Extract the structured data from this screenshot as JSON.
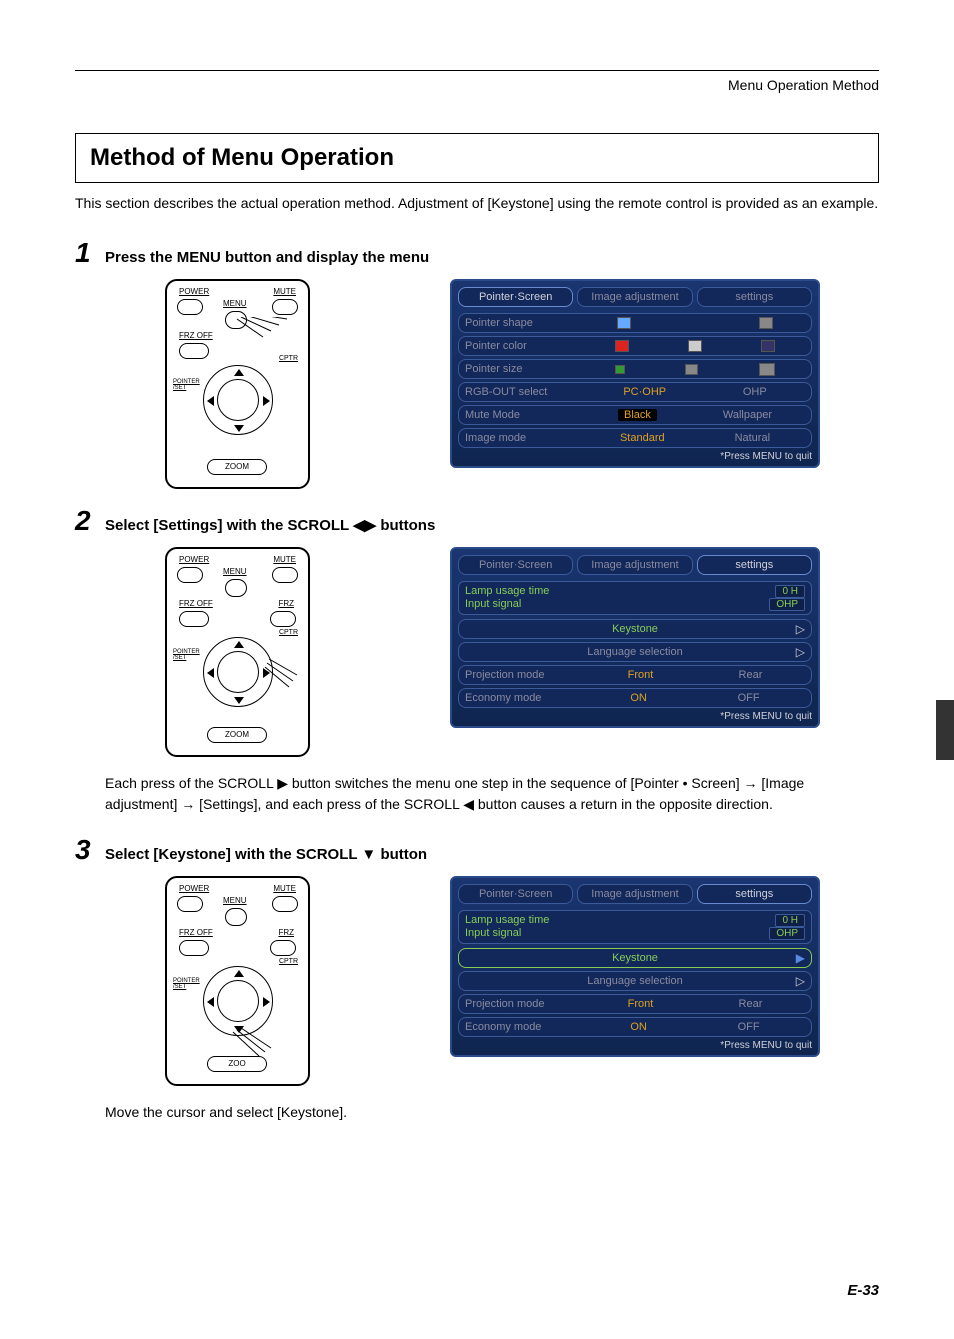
{
  "header": "Menu Operation Method",
  "title": "Method of Menu Operation",
  "intro": "This section describes the actual operation method. Adjustment of [Keystone] using the remote control is provided as an example.",
  "steps": [
    {
      "num": "1",
      "title": "Press the MENU button and display the menu",
      "remote_labels": {
        "power": "POWER",
        "mute": "MUTE",
        "menu": "MENU",
        "frzoff": "FRZ OFF",
        "frz": "FRZ",
        "cptr": "CPTR",
        "pointer": "POINTER\n/SET",
        "zoom": "ZOOM"
      }
    },
    {
      "num": "2",
      "title": "Select [Settings] with the SCROLL ◀▶ buttons",
      "body": "Each press of the SCROLL ▶ button switches the menu one step in the sequence of [Pointer • Screen] → [Image adjustment] → [Settings], and each press of the SCROLL ◀ button causes a return in the opposite direction."
    },
    {
      "num": "3",
      "title": "Select [Keystone] with the SCROLL ▼ button",
      "body": "Move the cursor and select [Keystone]."
    }
  ],
  "osd1": {
    "tabs": [
      "Pointer·Screen",
      "Image adjustment",
      "settings"
    ],
    "active": 0,
    "rows": [
      {
        "label": "Pointer shape",
        "type": "swatches",
        "opts": [
          "cursor",
          "",
          "line"
        ]
      },
      {
        "label": "Pointer color",
        "type": "swatches",
        "opts": [
          "r",
          "g",
          "b"
        ]
      },
      {
        "label": "Pointer size",
        "type": "swatches",
        "opts": [
          "sm",
          "md",
          "lg"
        ]
      },
      {
        "label": "RGB-OUT select",
        "type": "text",
        "opts": [
          "PC·OHP",
          "OHP"
        ],
        "hl": 0
      },
      {
        "label": "Mute Mode",
        "type": "text",
        "opts": [
          "Black",
          "Wallpaper"
        ],
        "hl": 0,
        "blk": true
      },
      {
        "label": "Image mode",
        "type": "text",
        "opts": [
          "Standard",
          "Natural"
        ],
        "hl": 0
      }
    ],
    "quit": "*Press MENU to quit"
  },
  "osd2": {
    "tabs": [
      "Pointer·Screen",
      "Image adjustment",
      "settings"
    ],
    "active": 2,
    "info": [
      {
        "label": "Lamp usage time",
        "val": "0 H"
      },
      {
        "label": "Input signal",
        "val": "OHP"
      }
    ],
    "btns": [
      "Keystone",
      "Language selection"
    ],
    "sel_btn": -1,
    "rows": [
      {
        "label": "Projection mode",
        "opts": [
          "Front",
          "Rear"
        ],
        "hl": 0
      },
      {
        "label": "Economy mode",
        "opts": [
          "ON",
          "OFF"
        ],
        "hl": 0
      }
    ],
    "quit": "*Press MENU to quit"
  },
  "osd3": {
    "tabs": [
      "Pointer·Screen",
      "Image adjustment",
      "settings"
    ],
    "active": 2,
    "info": [
      {
        "label": "Lamp usage time",
        "val": "0 H"
      },
      {
        "label": "Input signal",
        "val": "OHP"
      }
    ],
    "btns": [
      "Keystone",
      "Language selection"
    ],
    "sel_btn": 0,
    "rows": [
      {
        "label": "Projection mode",
        "opts": [
          "Front",
          "Rear"
        ],
        "hl": 0
      },
      {
        "label": "Economy mode",
        "opts": [
          "ON",
          "OFF"
        ],
        "hl": 0
      }
    ],
    "quit": "*Press MENU to quit"
  },
  "page_num": "E-33"
}
